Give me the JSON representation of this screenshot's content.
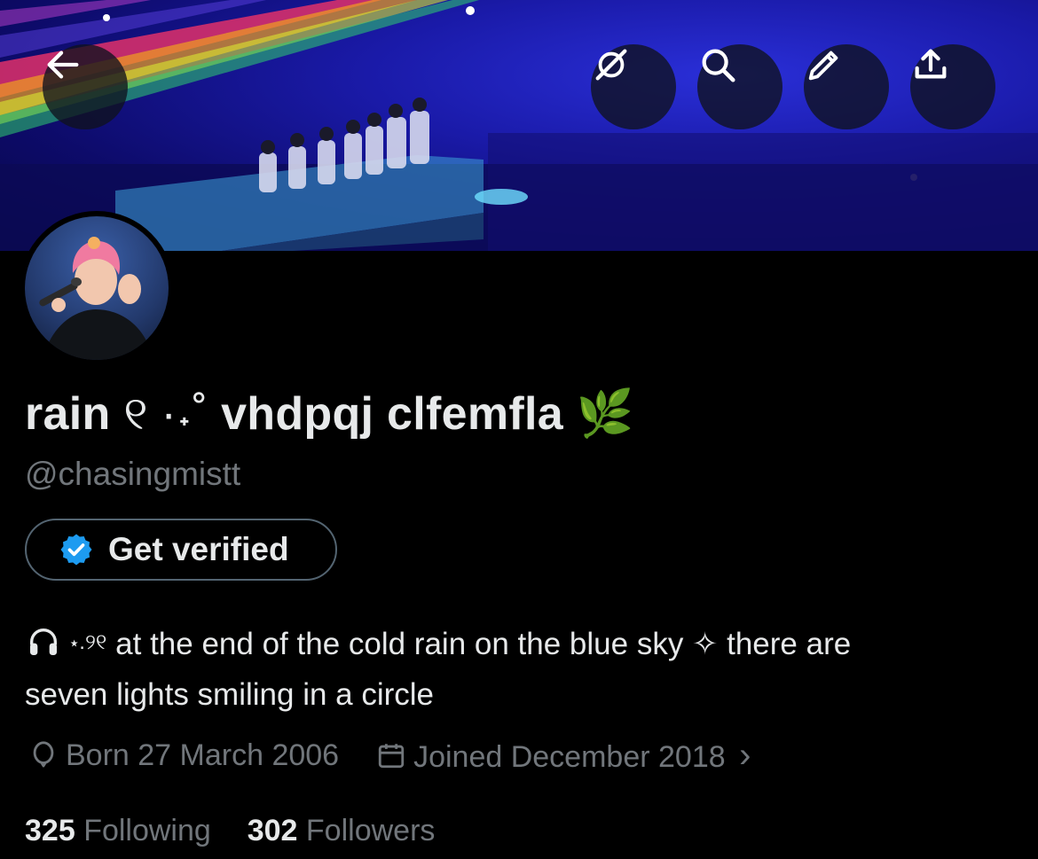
{
  "header": {
    "back_icon": "arrow-left-icon",
    "actions": [
      {
        "name": "grok-icon"
      },
      {
        "name": "search-icon"
      },
      {
        "name": "edit-icon"
      },
      {
        "name": "share-icon"
      }
    ]
  },
  "profile": {
    "display_name_start": "rain",
    "display_name_deco": "୧ ·˖˚",
    "display_name_end": "vhdpqj clfemfla",
    "display_name_emoji": "🌿",
    "handle": "@chasingmistt",
    "verify_label": "Get verified",
    "bio_line1_deco": "⋆.୨୧",
    "bio_line1": "at the end of the cold rain on the blue sky ✧ there are",
    "bio_line2": "seven lights smiling in a circle",
    "born": "Born 27 March 2006",
    "joined": "Joined December 2018",
    "joined_chevron": "›",
    "following_count": "325",
    "following_label": "Following",
    "followers_count": "302",
    "followers_label": "Followers"
  },
  "colors": {
    "background": "#000000",
    "text_primary": "#e7e9ea",
    "text_secondary": "#71767b",
    "verified_badge": "#1d9bf0"
  }
}
